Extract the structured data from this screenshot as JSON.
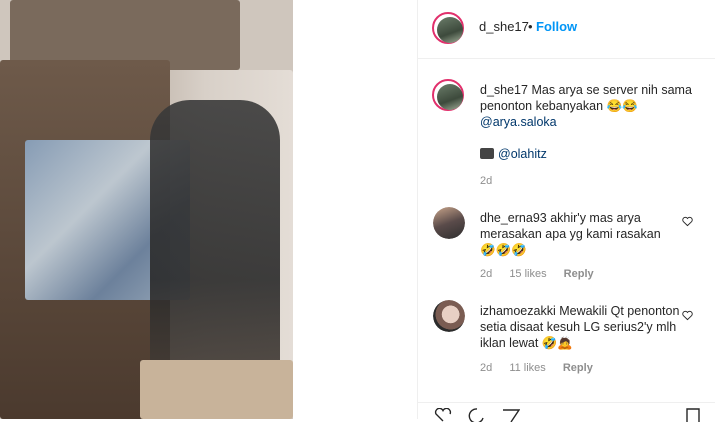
{
  "post": {
    "author": "d_she17",
    "separator": "•",
    "follow_label": "Follow",
    "caption_user": "d_she17",
    "caption_text": "Mas arya se server nih sama penonton kebanyakan",
    "caption_emoji": "😂😂",
    "caption_mention": "@arya.saloka",
    "credit_icon": "camera-emoji",
    "credit_mention": "@olahitz",
    "caption_age": "2d"
  },
  "comments": [
    {
      "user": "dhe_erna93",
      "text": "akhir'y mas arya merasakan apa yg kami rasakan",
      "emoji": "🤣🤣🤣",
      "age": "2d",
      "likes": "15 likes",
      "reply": "Reply"
    },
    {
      "user": "izhamoezakki",
      "text": "Mewakili Qt penonton setia disaat kesuh LG serius2'y mlh iklan lewat",
      "emoji": "🤣🙇",
      "age": "2d",
      "likes": "11 likes",
      "reply": "Reply"
    }
  ],
  "colors": {
    "link_blue": "#0095f6",
    "mention": "#00376b",
    "meta_gray": "#8e8e8e"
  }
}
